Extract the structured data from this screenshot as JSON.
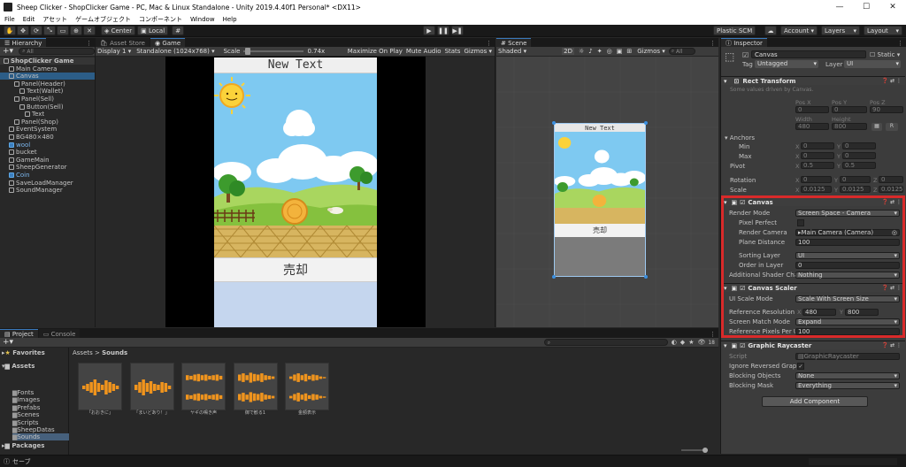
{
  "window": {
    "title": "Sheep Clicker - ShopClicker Game - PC, Mac & Linux Standalone - Unity 2019.4.40f1 Personal* <DX11>",
    "controls": [
      "—",
      "☐",
      "✕"
    ]
  },
  "menu": [
    "File",
    "Edit",
    "アセット",
    "ゲームオブジェクト",
    "コンポーネント",
    "Window",
    "Help"
  ],
  "toolbar": {
    "pivot": "Center",
    "space": "Local",
    "plastic": "Plastic SCM",
    "account": "Account",
    "layers": "Layers",
    "layout": "Layout"
  },
  "hierarchy": {
    "tab": "Hierarchy",
    "search": "All",
    "items": [
      {
        "label": "ShopClicker Game",
        "depth": 0,
        "bold": true,
        "selected": false
      },
      {
        "label": "Main Camera",
        "depth": 1
      },
      {
        "label": "Canvas",
        "depth": 1,
        "selected": true
      },
      {
        "label": "Panel(Header)",
        "depth": 2
      },
      {
        "label": "Text(Wallet)",
        "depth": 3
      },
      {
        "label": "Panel(Sell)",
        "depth": 2
      },
      {
        "label": "Button(Sell)",
        "depth": 3
      },
      {
        "label": "Text",
        "depth": 4
      },
      {
        "label": "Panel(Shop)",
        "depth": 2
      },
      {
        "label": "EventSystem",
        "depth": 1
      },
      {
        "label": "BG480×480",
        "depth": 1
      },
      {
        "label": "wool",
        "depth": 1,
        "blue": true
      },
      {
        "label": "bucket",
        "depth": 1
      },
      {
        "label": "GameMain",
        "depth": 1
      },
      {
        "label": "SheepGenerator",
        "depth": 1
      },
      {
        "label": "Coin",
        "depth": 1,
        "blue": true
      },
      {
        "label": "SaveLoadManager",
        "depth": 1
      },
      {
        "label": "SoundManager",
        "depth": 1
      }
    ]
  },
  "game": {
    "tabs": [
      "Asset Store",
      "Game"
    ],
    "display": "Display 1",
    "resolution": "Standalone (1024x768)",
    "scale_label": "Scale",
    "scale_value": "0.74x",
    "options": [
      "Maximize On Play",
      "Mute Audio",
      "Stats",
      "Gizmos"
    ],
    "header_text": "New Text",
    "sell_text": "売却"
  },
  "scene": {
    "tab": "Scene",
    "shading": "Shaded",
    "mode_2d": "2D",
    "gizmos": "Gizmos",
    "search": "All",
    "header_text": "New Text",
    "sell_text": "売却"
  },
  "inspector": {
    "tab": "Inspector",
    "object_name": "Canvas",
    "static_label": "Static",
    "tag_label": "Tag",
    "tag_value": "Untagged",
    "layer_label": "Layer",
    "layer_value": "UI",
    "rect": {
      "title": "Rect Transform",
      "note": "Some values driven by Canvas.",
      "pos_labels": [
        "Pos X",
        "Pos Y",
        "Pos Z"
      ],
      "pos_values": [
        "0",
        "0",
        "90"
      ],
      "width_label": "Width",
      "height_label": "Height",
      "width": "480",
      "height": "800",
      "anchors": "Anchors",
      "min": "Min",
      "max": "Max",
      "pivot": "Pivot",
      "rotation": "Rotation",
      "scale": "Scale",
      "min_x": "0",
      "min_y": "0",
      "max_x": "0",
      "max_y": "0",
      "pivot_x": "0.5",
      "pivot_y": "0.5",
      "rot_x": "0",
      "rot_y": "0",
      "rot_z": "0",
      "scale_x": "0.0125",
      "scale_y": "0.0125",
      "scale_z": "0.0125",
      "r_btn": "R"
    },
    "canvas": {
      "title": "Canvas",
      "render_mode_label": "Render Mode",
      "render_mode": "Screen Space - Camera",
      "pixel_perfect": "Pixel Perfect",
      "render_camera_label": "Render Camera",
      "render_camera": "Main Camera (Camera)",
      "plane_distance_label": "Plane Distance",
      "plane_distance": "100",
      "sorting_layer_label": "Sorting Layer",
      "sorting_layer": "UI",
      "order_label": "Order in Layer",
      "order": "0",
      "shader_label": "Additional Shader Chan",
      "shader": "Nothing"
    },
    "scaler": {
      "title": "Canvas Scaler",
      "ui_scale_label": "UI Scale Mode",
      "ui_scale": "Scale With Screen Size",
      "ref_res_label": "Reference Resolution",
      "ref_x": "480",
      "ref_y": "800",
      "match_label": "Screen Match Mode",
      "match": "Expand",
      "ppu_label": "Reference Pixels Per Ur",
      "ppu": "100"
    },
    "raycaster": {
      "title": "Graphic Raycaster",
      "script_label": "Script",
      "script": "GraphicRaycaster",
      "ignore_label": "Ignore Reversed Graph",
      "blocking_label": "Blocking Objects",
      "blocking": "None",
      "mask_label": "Blocking Mask",
      "mask": "Everything"
    },
    "add_component": "Add Component"
  },
  "project": {
    "tabs": [
      "Project",
      "Console"
    ],
    "favorites": "Favorites",
    "assets": "Assets",
    "folders": [
      "Fonts",
      "Images",
      "Prefabs",
      "Scenes",
      "Scripts",
      "SheepDatas",
      "Sounds"
    ],
    "packages": "Packages",
    "breadcrumb": [
      "Assets",
      ">",
      "Sounds"
    ],
    "count": "18",
    "sounds": [
      "「おおきに」",
      "「まいどあり！」",
      "ヤギの鳴き声",
      "御で歓る1",
      "金額表示"
    ]
  },
  "status": {
    "text": "セーブ"
  },
  "colors": {
    "highlight": "#d92a2a",
    "selected": "#2c5d87",
    "accent": "#3a79bb"
  }
}
